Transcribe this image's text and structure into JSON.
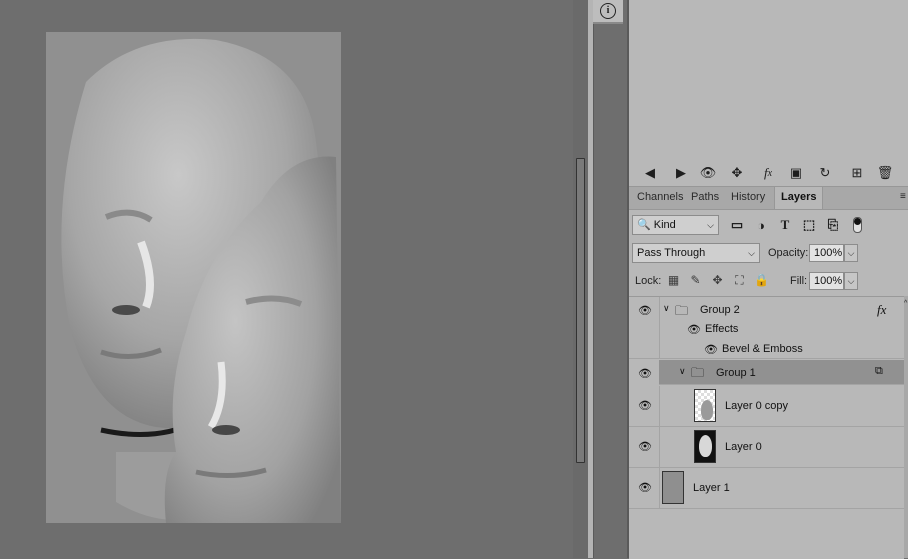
{
  "info_icon": "info-circle-icon",
  "panel": {
    "anim_icons": [
      "prev-frame-icon",
      "play-icon",
      "visibility-icon",
      "move-icon",
      "fx-icon",
      "new-frame-icon",
      "loop-icon",
      "add-icon",
      "trash-icon"
    ],
    "tabs": [
      {
        "label": "Channels",
        "active": false
      },
      {
        "label": "Paths",
        "active": false
      },
      {
        "label": "History",
        "active": false
      },
      {
        "label": "Layers",
        "active": true
      }
    ],
    "filter": {
      "kind": "Kind"
    },
    "blend": {
      "mode": "Pass Through",
      "opacity_label": "Opacity:",
      "opacity": "100%"
    },
    "lock": {
      "label": "Lock:",
      "fill_label": "Fill:",
      "fill": "100%"
    },
    "layers": [
      {
        "name": "Group 2",
        "type": "group",
        "fx": "fx"
      },
      {
        "name": "Effects",
        "type": "effects"
      },
      {
        "name": "Bevel & Emboss",
        "type": "effect"
      },
      {
        "name": "Group 1",
        "type": "group",
        "selected": true
      },
      {
        "name": "Layer 0 copy",
        "type": "layer"
      },
      {
        "name": "Layer 0",
        "type": "layer"
      },
      {
        "name": "Layer 1",
        "type": "layer"
      }
    ]
  }
}
